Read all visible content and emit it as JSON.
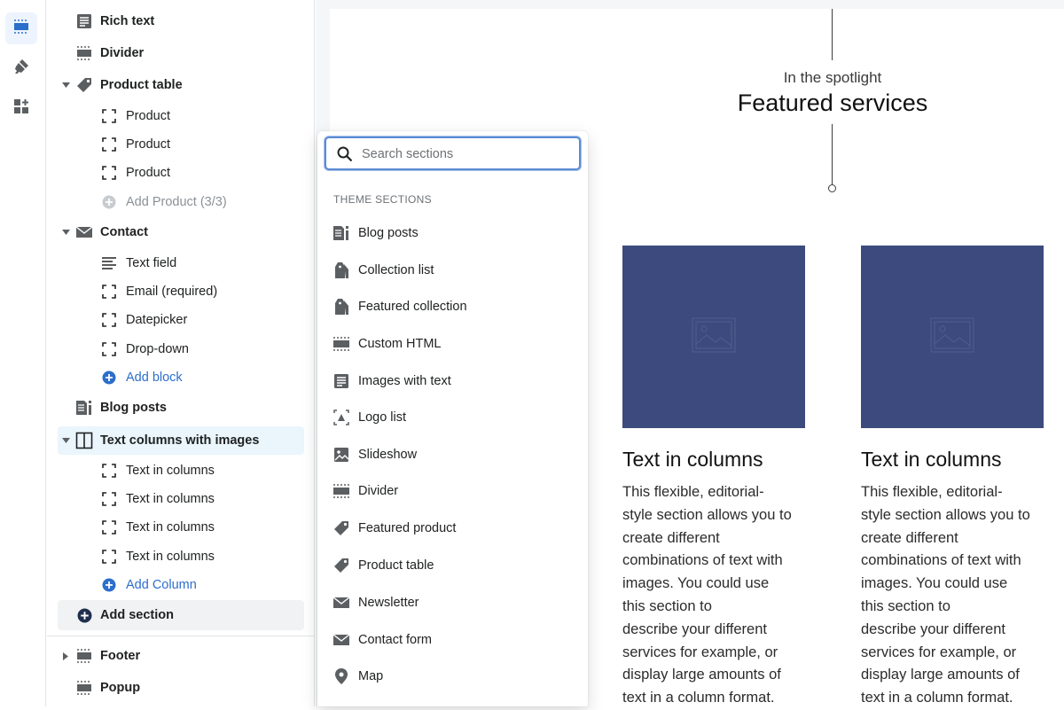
{
  "rail": {
    "items": [
      {
        "icon": "sections-icon",
        "active": true
      },
      {
        "icon": "theme-settings-brush-icon",
        "active": false
      },
      {
        "icon": "apps-icon",
        "active": false
      }
    ]
  },
  "tree": {
    "rows": [
      {
        "label": "Rich text",
        "icon": "rich-text-icon",
        "level": 1
      },
      {
        "label": "Divider",
        "icon": "divider-icon",
        "level": 1
      },
      {
        "label": "Product table",
        "icon": "tag-icon",
        "level": 1,
        "expanded": true
      },
      {
        "label": "Product",
        "icon": "block-icon",
        "level": 2
      },
      {
        "label": "Product",
        "icon": "block-icon",
        "level": 2
      },
      {
        "label": "Product",
        "icon": "block-icon",
        "level": 2
      },
      {
        "label": "Add Product (3/3)",
        "icon": "add-circle-icon",
        "level": 2,
        "disabled": true
      },
      {
        "label": "Contact",
        "icon": "envelope-icon",
        "level": 1,
        "expanded": true
      },
      {
        "label": "Text field",
        "icon": "text-lines-icon",
        "level": 2
      },
      {
        "label": "Email (required)",
        "icon": "block-icon",
        "level": 2
      },
      {
        "label": "Datepicker",
        "icon": "block-icon",
        "level": 2
      },
      {
        "label": "Drop-down",
        "icon": "block-icon",
        "level": 2
      },
      {
        "label": "Add block",
        "icon": "add-circle-icon",
        "level": 2,
        "link": true
      },
      {
        "label": "Blog posts",
        "icon": "blog-icon",
        "level": 1
      },
      {
        "label": "Text columns with images",
        "icon": "columns-icon",
        "level": 1,
        "expanded": true,
        "highlighted": true
      },
      {
        "label": "Text in columns",
        "icon": "block-icon",
        "level": 2
      },
      {
        "label": "Text in columns",
        "icon": "block-icon",
        "level": 2
      },
      {
        "label": "Text in columns",
        "icon": "block-icon",
        "level": 2
      },
      {
        "label": "Text in columns",
        "icon": "block-icon",
        "level": 2
      },
      {
        "label": "Add Column",
        "icon": "add-circle-icon",
        "level": 2,
        "link": true
      },
      {
        "label": "Add section",
        "icon": "add-circle-filled-icon",
        "level": 1
      },
      {
        "label": "Footer",
        "icon": "divider-icon",
        "level": 1,
        "collapsed": true
      },
      {
        "label": "Popup",
        "icon": "divider-icon",
        "level": 1
      }
    ]
  },
  "popover": {
    "search_placeholder": "Search sections",
    "search_value": "",
    "section_heading": "THEME SECTIONS",
    "options": [
      {
        "label": "Blog posts",
        "icon": "blog-icon"
      },
      {
        "label": "Collection list",
        "icon": "collection-tag-icon"
      },
      {
        "label": "Featured collection",
        "icon": "collection-tag-icon"
      },
      {
        "label": "Custom HTML",
        "icon": "divider-icon"
      },
      {
        "label": "Images with text",
        "icon": "rich-text-icon"
      },
      {
        "label": "Logo list",
        "icon": "logo-icon"
      },
      {
        "label": "Slideshow",
        "icon": "image-icon"
      },
      {
        "label": "Divider",
        "icon": "divider-icon"
      },
      {
        "label": "Featured product",
        "icon": "tag-icon"
      },
      {
        "label": "Product table",
        "icon": "tag-icon"
      },
      {
        "label": "Newsletter",
        "icon": "envelope-icon"
      },
      {
        "label": "Contact form",
        "icon": "envelope-icon"
      },
      {
        "label": "Map",
        "icon": "map-pin-icon"
      }
    ]
  },
  "preview": {
    "kicker": "In the spotlight",
    "title": "Featured services",
    "columns": [
      {
        "title": "Text in columns",
        "body": [
          "This flexible, editorial-",
          "style section allows you to",
          "create different",
          "combinations of text with",
          "images. You could use",
          "this section to",
          "describe your different",
          "services for example, or",
          "display large amounts of",
          "text in a column format."
        ]
      },
      {
        "title": "Text in columns",
        "body": [
          "This flexible, editorial-",
          "style section allows you to",
          "create different",
          "combinations of text with",
          "images. You could use",
          "this section to",
          "describe your different",
          "services for example, or",
          "display large amounts of",
          "text in a column format."
        ]
      }
    ]
  },
  "colors": {
    "accent": "#2c6ecb",
    "image_placeholder": "#3c4a7d",
    "highlight_row": "#eaf6fb"
  }
}
